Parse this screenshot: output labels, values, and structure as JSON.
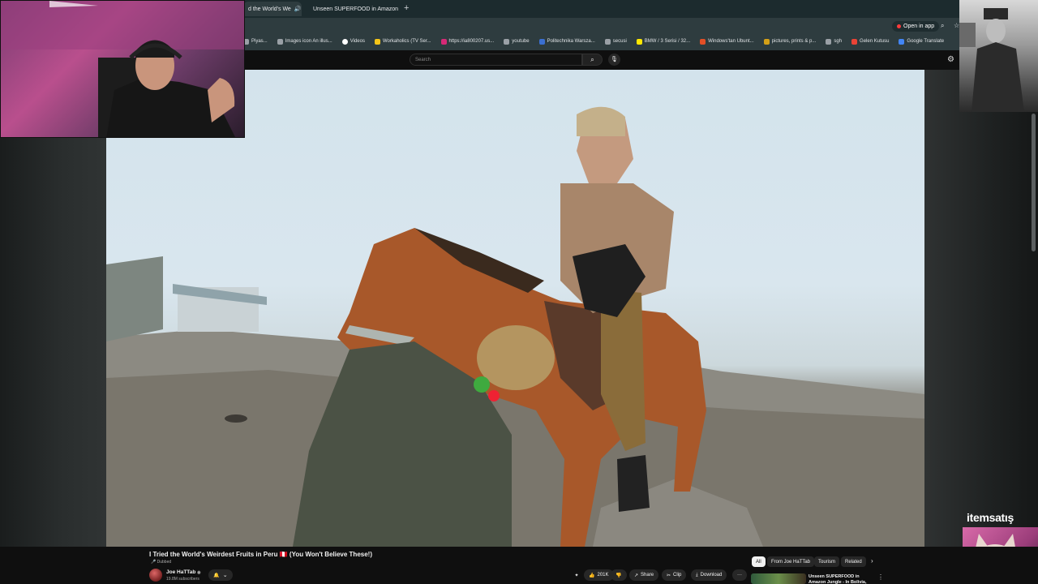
{
  "browser": {
    "tabs": [
      {
        "label": "d the World's We",
        "audio": "🔊",
        "active": true
      },
      {
        "label": "Unseen SUPERFOOD in Amazon",
        "active": false
      }
    ],
    "new_tab": "+",
    "close_glyph": "×",
    "bookmarks": [
      {
        "label": "Piyas...",
        "icon": "globe-icon",
        "color": "#9aa0a6"
      },
      {
        "label": "Images icon An illus...",
        "icon": "page-icon",
        "color": "#9aa0a6"
      },
      {
        "label": "Videos",
        "icon": "google-icon",
        "color": "#ffffff"
      },
      {
        "label": "Workaholics (TV Ser...",
        "icon": "imdb-icon",
        "color": "#f5c518"
      },
      {
        "label": "https://ia800207.us...",
        "icon": "instagram-icon",
        "color": "#d62976"
      },
      {
        "label": "https://ia800207.us...",
        "icon": "page-icon",
        "color": "#9aa0a6"
      },
      {
        "label": "youtube",
        "icon": "folder-icon",
        "color": "#9aa0a6"
      },
      {
        "label": "Politechnika Warsza...",
        "icon": "pw-icon",
        "color": "#3b6fd1"
      },
      {
        "label": "secusi",
        "icon": "folder-icon",
        "color": "#9aa0a6"
      },
      {
        "label": "BMW / 3 Serisi / 32...",
        "icon": "sahibinden-icon",
        "color": "#ffe800"
      },
      {
        "label": "Windows'tan Ubunt...",
        "icon": "web-icon",
        "color": "#e34f26"
      },
      {
        "label": "pictures, prints & p...",
        "icon": "pin-icon",
        "color": "#d4a017"
      },
      {
        "label": "sgh",
        "icon": "folder-icon",
        "color": "#9aa0a6"
      },
      {
        "label": "Gelen Kutusu",
        "icon": "gmail-icon",
        "color": "#ea4335"
      },
      {
        "label": "Google Translate",
        "icon": "translate-icon",
        "color": "#4285f4"
      }
    ],
    "open_in_app": "Open in app"
  },
  "youtube": {
    "search_placeholder": "Search",
    "search_glyph": "⌕",
    "mic_glyph": "🎙",
    "settings_glyph": "⚙",
    "video": {
      "title": "I Tried the World's Weirdest Fruits in Peru 🇵🇪 (You Won't Believe These!)",
      "dubbed": "🎤 Dubbed",
      "channel": "Joe HaTTab",
      "verified": "◉",
      "subscribers": "19.8M subscribers",
      "bell": "🔔",
      "chevron": "⌄",
      "likes": "201K",
      "like_glyph": "👍",
      "dislike_glyph": "👎",
      "share": "Share",
      "share_glyph": "↗",
      "clip": "Clip",
      "clip_glyph": "✂",
      "download": "Download",
      "download_glyph": "⤓",
      "more": "···",
      "sparkle": "✦"
    },
    "chips": [
      "All",
      "From Joe HaTTab",
      "Tourism",
      "Related"
    ],
    "chips_next": "›",
    "recommended": {
      "title": "Unseen SUPERFOOD in Amazon Jungle - In Bolivia, Brazil or...",
      "more": "⋮"
    }
  },
  "overlay": {
    "sponsor": "itemsatış"
  }
}
